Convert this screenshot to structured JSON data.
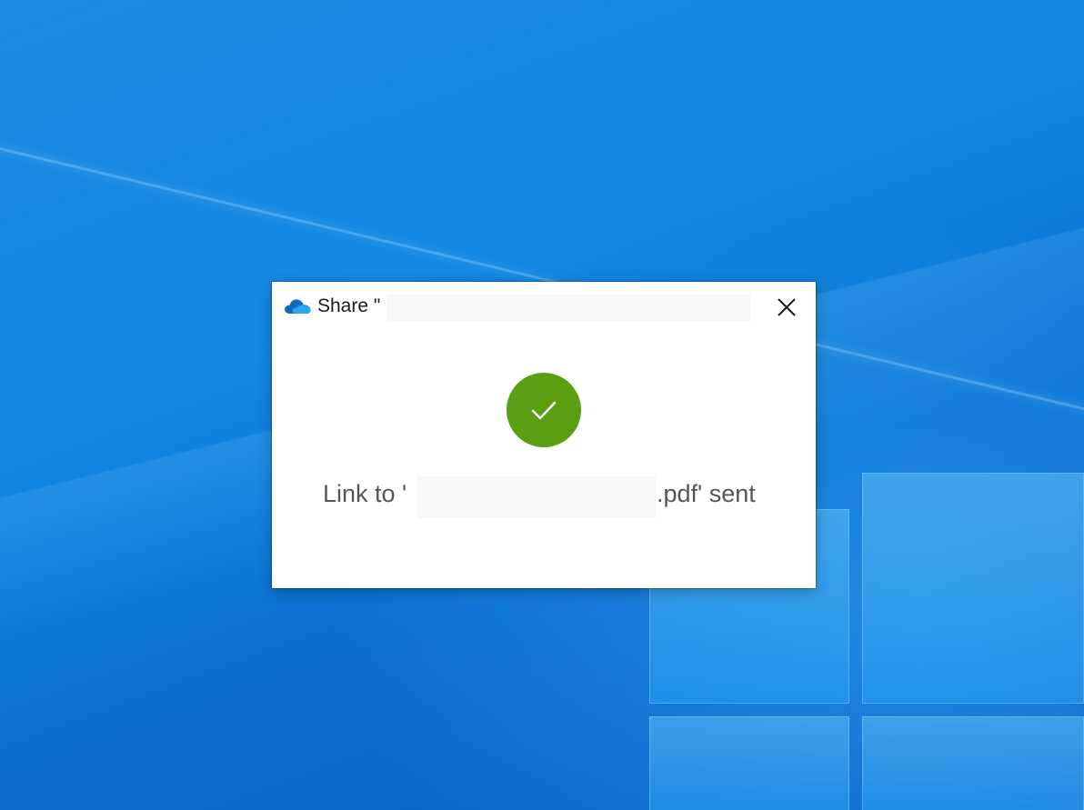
{
  "desktop": {
    "background_color": "#0a78d6"
  },
  "dialog": {
    "app_icon": "onedrive-cloud-icon",
    "title_prefix": "Share \"",
    "close_icon": "close-icon",
    "success_icon": "checkmark-icon",
    "success_color": "#5a9e12",
    "message_prefix": "Link to '",
    "message_suffix": ".pdf' sent"
  }
}
